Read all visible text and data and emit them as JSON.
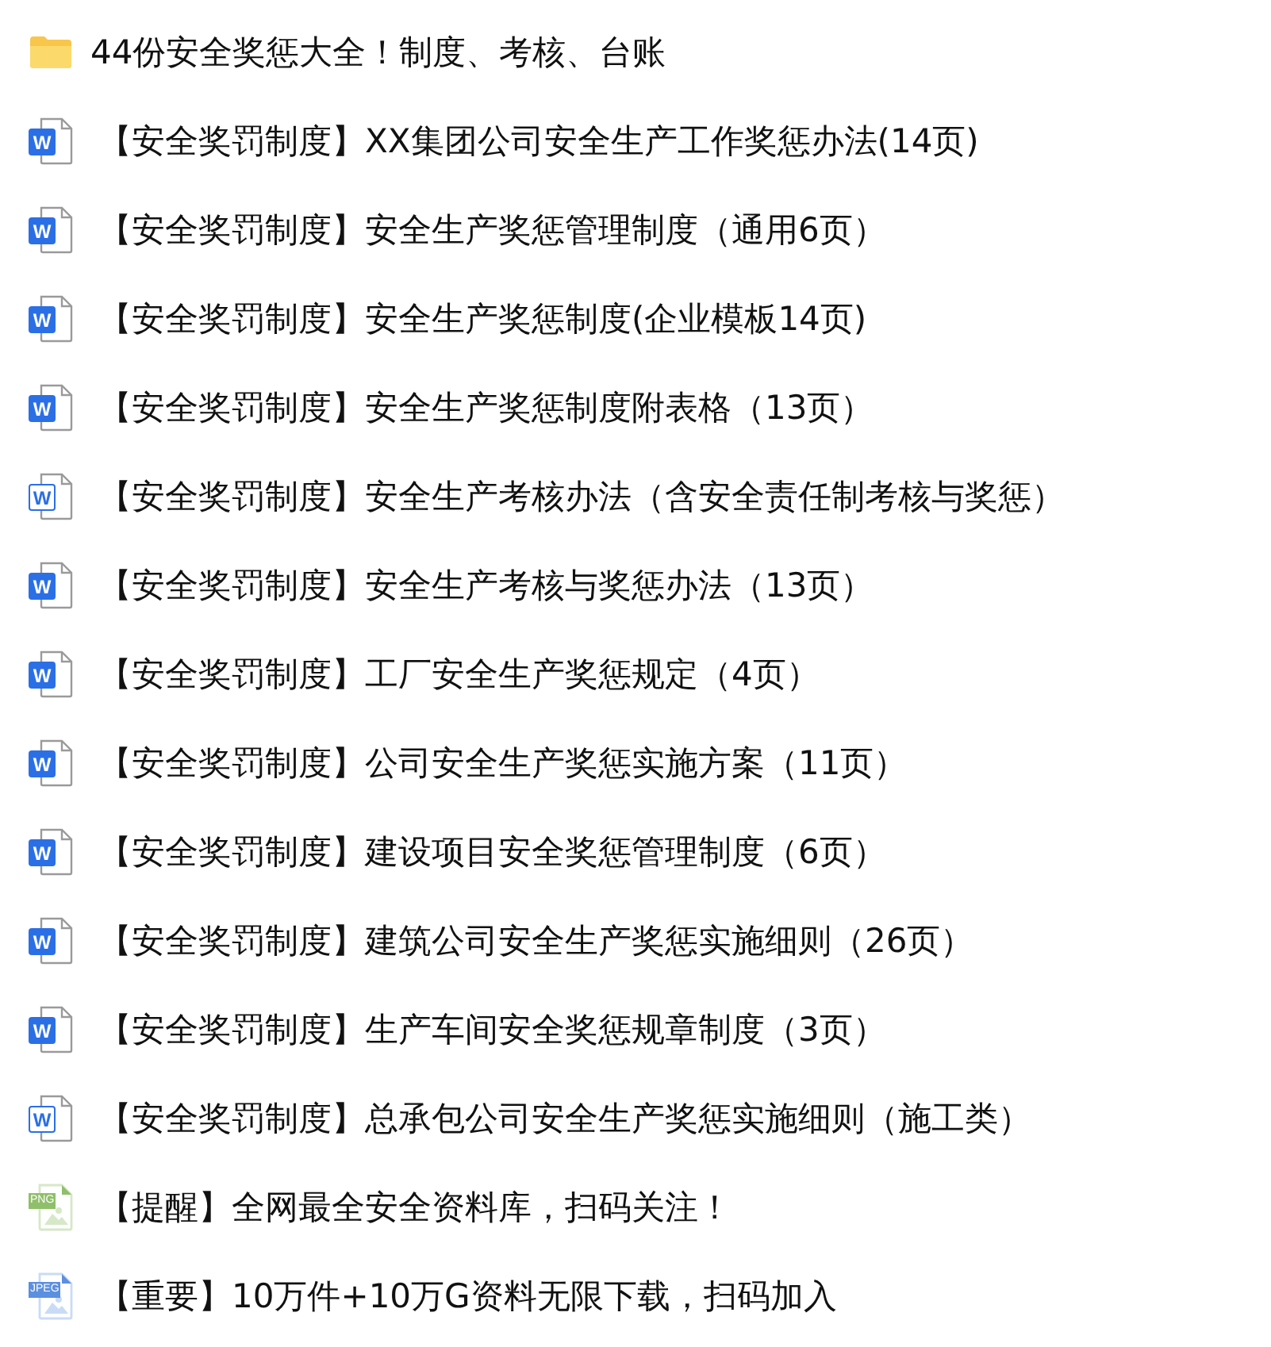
{
  "items": [
    {
      "kind": "folder",
      "title": "44份安全奖惩大全！制度、考核、台账"
    },
    {
      "kind": "word",
      "badge": "W",
      "title": "【安全奖罚制度】XX集团公司安全生产工作奖惩办法(14页)"
    },
    {
      "kind": "word",
      "badge": "W",
      "title": "【安全奖罚制度】安全生产奖惩管理制度（通用6页）"
    },
    {
      "kind": "word",
      "badge": "W",
      "title": "【安全奖罚制度】安全生产奖惩制度(企业模板14页)"
    },
    {
      "kind": "word",
      "badge": "W",
      "title": "【安全奖罚制度】安全生产奖惩制度附表格（13页）"
    },
    {
      "kind": "word-outline",
      "badge": "W",
      "title": "【安全奖罚制度】安全生产考核办法（含安全责任制考核与奖惩）"
    },
    {
      "kind": "word",
      "badge": "W",
      "title": "【安全奖罚制度】安全生产考核与奖惩办法（13页）"
    },
    {
      "kind": "word",
      "badge": "W",
      "title": "【安全奖罚制度】工厂安全生产奖惩规定（4页）"
    },
    {
      "kind": "word",
      "badge": "W",
      "title": "【安全奖罚制度】公司安全生产奖惩实施方案（11页）"
    },
    {
      "kind": "word",
      "badge": "W",
      "title": "【安全奖罚制度】建设项目安全奖惩管理制度（6页）"
    },
    {
      "kind": "word",
      "badge": "W",
      "title": "【安全奖罚制度】建筑公司安全生产奖惩实施细则（26页）"
    },
    {
      "kind": "word",
      "badge": "W",
      "title": "【安全奖罚制度】生产车间安全奖惩规章制度（3页）"
    },
    {
      "kind": "word-outline",
      "badge": "W",
      "title": "【安全奖罚制度】总承包公司安全生产奖惩实施细则（施工类）"
    },
    {
      "kind": "png",
      "badge": "PNG",
      "title": "【提醒】全网最全安全资料库，扫码关注！"
    },
    {
      "kind": "jpeg",
      "badge": "JPEG",
      "title": "【重要】10万件+10万G资料无限下载，扫码加入"
    }
  ]
}
